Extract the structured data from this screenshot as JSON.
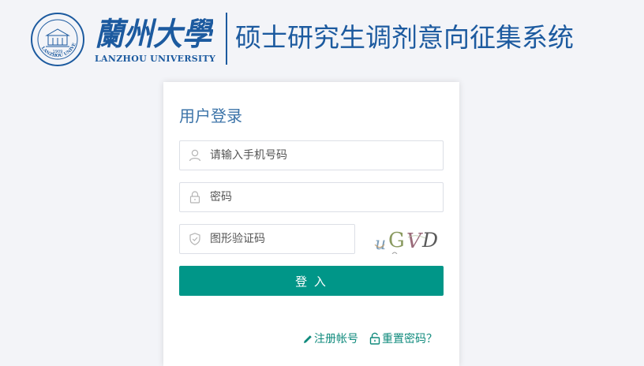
{
  "header": {
    "university_cn": "蘭州大學",
    "university_en": "LANZHOU UNIVERSITY",
    "seal_year": "1909",
    "seal_text": "LANZHOU UNIVERSITY",
    "system_title": "硕士研究生调剂意向征集系统",
    "brand_color": "#1c5a9f"
  },
  "login": {
    "title": "用户登录",
    "phone_placeholder": "请输入手机号码",
    "password_placeholder": "密码",
    "captcha_placeholder": "图形验证码",
    "captcha_text": "uGVD",
    "submit_label": "登 入",
    "accent_color": "#009688"
  },
  "links": {
    "register": "注册帐号",
    "reset_password": "重置密码？"
  },
  "icons": {
    "user": "user-icon",
    "lock": "lock-icon",
    "shield": "shield-icon",
    "pencil": "pencil-icon",
    "unlock": "unlock-icon"
  }
}
